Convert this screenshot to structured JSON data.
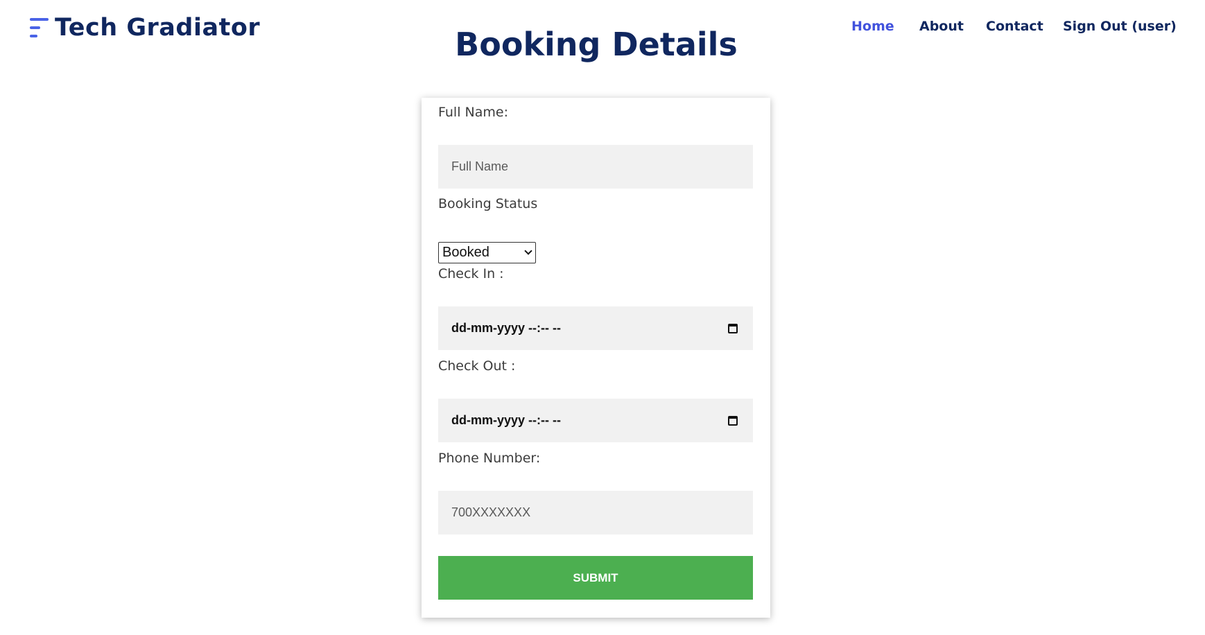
{
  "brand": {
    "name": "Tech Gradiator",
    "accent": "#4a63e7",
    "navy": "#10275f"
  },
  "nav": {
    "items": [
      {
        "label": "Home",
        "active": true
      },
      {
        "label": "About",
        "active": false
      },
      {
        "label": "Contact",
        "active": false
      },
      {
        "label": "Sign Out (user)",
        "active": false
      }
    ]
  },
  "page": {
    "title": "Booking Details"
  },
  "form": {
    "full_name": {
      "label": "Full Name:",
      "placeholder": "Full Name",
      "value": ""
    },
    "booking_status": {
      "label": "Booking Status",
      "selected": "Booked"
    },
    "check_in": {
      "label": "Check In :",
      "value": "dd-mm-yyyy --:-- --"
    },
    "check_out": {
      "label": "Check Out :",
      "value": "dd-mm-yyyy --:-- --"
    },
    "phone": {
      "label": "Phone Number:",
      "placeholder": "700XXXXXXX",
      "value": ""
    },
    "submit_label": "SUBMIT",
    "submit_color": "#4caf50"
  }
}
